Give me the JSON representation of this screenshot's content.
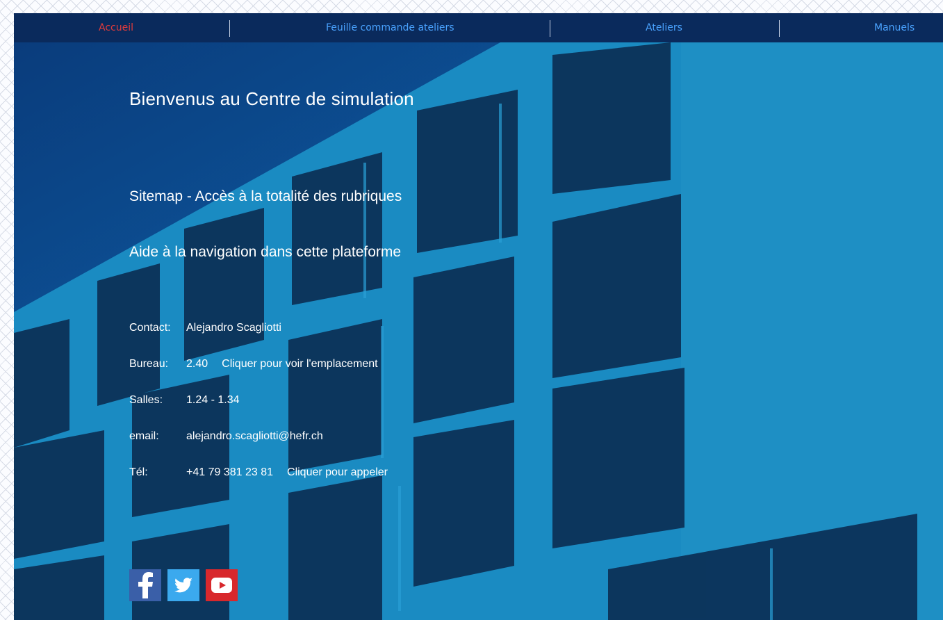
{
  "nav": {
    "items": [
      {
        "label": "Accueil",
        "active": true
      },
      {
        "label": "Feuille commande ateliers",
        "active": false
      },
      {
        "label": "Ateliers",
        "active": false
      },
      {
        "label": "Manuels",
        "active": false
      }
    ]
  },
  "main": {
    "title": "Bienvenus au Centre de simulation",
    "sitemap_link": "Sitemap - Accès à la totalité des rubriques",
    "aide_link": "Aide à la navigation dans cette plateforme"
  },
  "contact": {
    "contact_label": "Contact:",
    "contact_value": "Alejandro Scagliotti",
    "bureau_label": "Bureau:",
    "bureau_value": "2.40",
    "bureau_link": "Cliquer pour voir l'emplacement",
    "salles_label": "Salles:",
    "salles_value": "1.24 - 1.34",
    "email_label": "email:",
    "email_value": "alejandro.scagliotti@hefr.ch",
    "tel_label": "Tél:",
    "tel_value": "+41 79 381 23 81",
    "tel_link": "Cliquer pour appeler"
  },
  "social": {
    "icons": [
      "facebook-icon",
      "twitter-icon",
      "youtube-icon"
    ]
  },
  "colors": {
    "nav_bg": "#0a2a5c",
    "nav_link": "#4aa3ff",
    "nav_active": "#e33b3b",
    "facebook": "#3a5fa8",
    "twitter": "#3ba9ee",
    "youtube": "#d8282c"
  }
}
